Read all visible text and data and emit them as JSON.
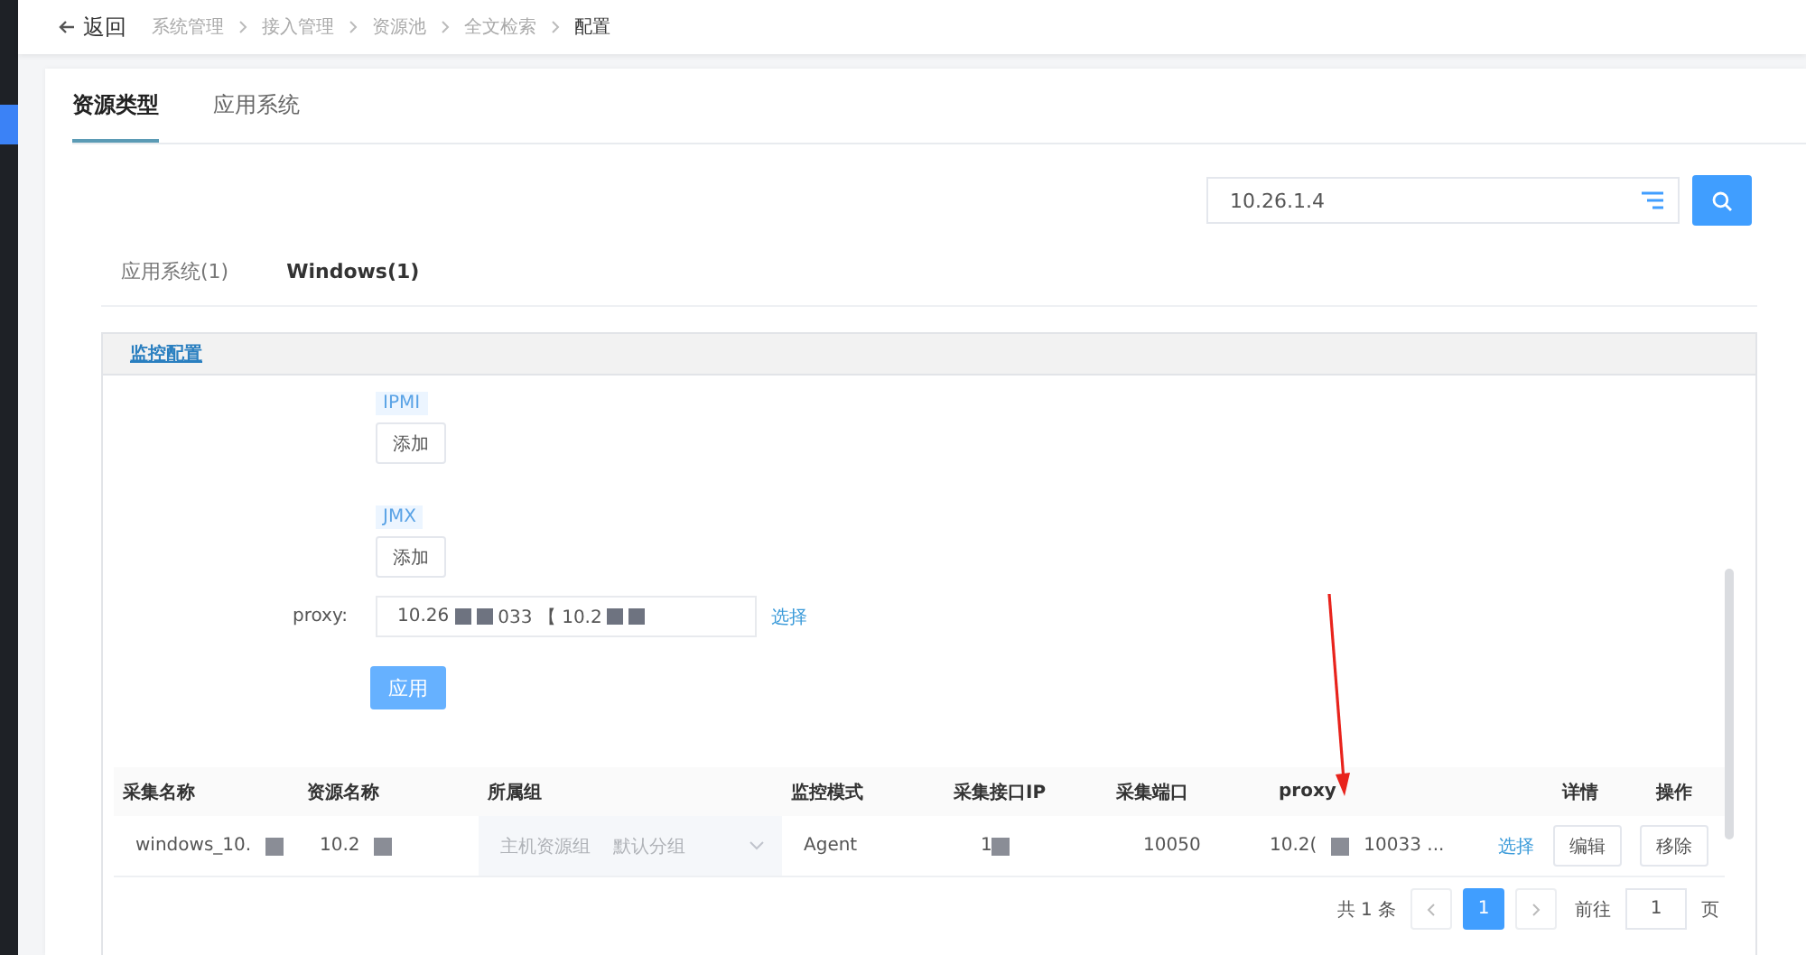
{
  "header": {
    "back": "返回",
    "breadcrumb": [
      {
        "label": "系统管理",
        "current": false
      },
      {
        "label": "接入管理",
        "current": false
      },
      {
        "label": "资源池",
        "current": false
      },
      {
        "label": "全文检索",
        "current": false
      },
      {
        "label": "配置",
        "current": true
      }
    ]
  },
  "tabs": [
    {
      "label": "资源类型",
      "selected": true
    },
    {
      "label": "应用系统",
      "selected": false
    }
  ],
  "search": {
    "value": "10.26.1.4"
  },
  "subtabs": [
    {
      "label": "应用系统(1)",
      "selected": false
    },
    {
      "label": "Windows(1)",
      "selected": true
    }
  ],
  "panel": {
    "title": "监控配置",
    "protocols": [
      {
        "tag": "IPMI",
        "button": "添加"
      },
      {
        "tag": "JMX",
        "button": "添加"
      }
    ],
    "proxy": {
      "label": "proxy:",
      "parts": [
        {
          "kind": "text",
          "text": "10.26"
        },
        {
          "kind": "redacted"
        },
        {
          "kind": "redacted"
        },
        {
          "kind": "text",
          "text": "033 【 10.2"
        },
        {
          "kind": "redacted"
        },
        {
          "kind": "redacted"
        }
      ],
      "link": "选择"
    },
    "apply": "应用"
  },
  "table": {
    "columns": [
      "采集名称",
      "资源名称",
      "所属组",
      "监控模式",
      "采集接口IP",
      "采集端口",
      "proxy",
      "详情",
      "操作"
    ],
    "rows": [
      {
        "collect_name": [
          {
            "kind": "text",
            "text": "windows_10."
          },
          {
            "kind": "redacted"
          }
        ],
        "resource_name": [
          {
            "kind": "text",
            "text": "10.2"
          },
          {
            "kind": "redacted"
          }
        ],
        "group": [
          "主机资源组",
          "默认分组"
        ],
        "mode": "Agent",
        "ip": [
          {
            "kind": "text",
            "text": "1"
          },
          {
            "kind": "redacted"
          }
        ],
        "port": "10050",
        "proxy": [
          {
            "kind": "text",
            "text": "10.2("
          },
          {
            "kind": "redacted"
          },
          {
            "kind": "text",
            "text": "10033 ..."
          }
        ],
        "proxy_link": "选择",
        "buttons": [
          "编辑",
          "移除"
        ]
      }
    ]
  },
  "pagination": {
    "total": "共 1 条",
    "pages": [
      {
        "label": "1",
        "selected": true
      }
    ],
    "goto": "前往",
    "page_input": "1",
    "unit": "页"
  }
}
